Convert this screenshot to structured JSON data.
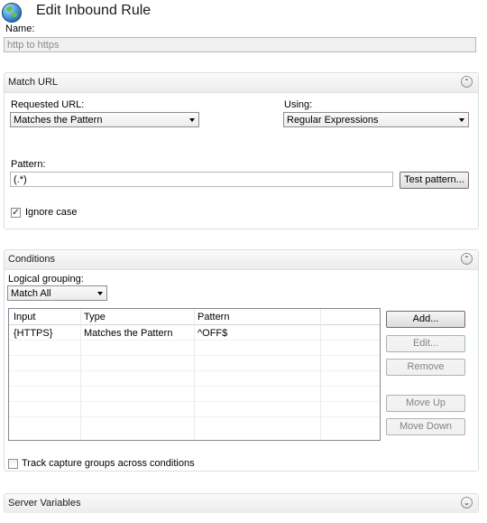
{
  "header": {
    "title": "Edit Inbound Rule",
    "icon": "globe-icon"
  },
  "name": {
    "label": "Name:",
    "value": "http to https"
  },
  "match_url": {
    "title": "Match URL",
    "requested_url_label": "Requested URL:",
    "requested_url_value": "Matches the Pattern",
    "using_label": "Using:",
    "using_value": "Regular Expressions",
    "pattern_label": "Pattern:",
    "pattern_value": "(.*)",
    "test_pattern_button": "Test pattern...",
    "ignore_case_label": "Ignore case",
    "ignore_case_checked": true
  },
  "conditions": {
    "title": "Conditions",
    "logical_grouping_label": "Logical grouping:",
    "logical_grouping_value": "Match All",
    "columns": [
      "Input",
      "Type",
      "Pattern"
    ],
    "rows": [
      {
        "input": "{HTTPS}",
        "type": "Matches the Pattern",
        "pattern": "^OFF$"
      }
    ],
    "buttons": {
      "add": "Add...",
      "edit": "Edit...",
      "remove": "Remove",
      "move_up": "Move Up",
      "move_down": "Move Down"
    },
    "track_capture_label": "Track capture groups across conditions",
    "track_capture_checked": false
  },
  "server_variables": {
    "title": "Server Variables"
  }
}
